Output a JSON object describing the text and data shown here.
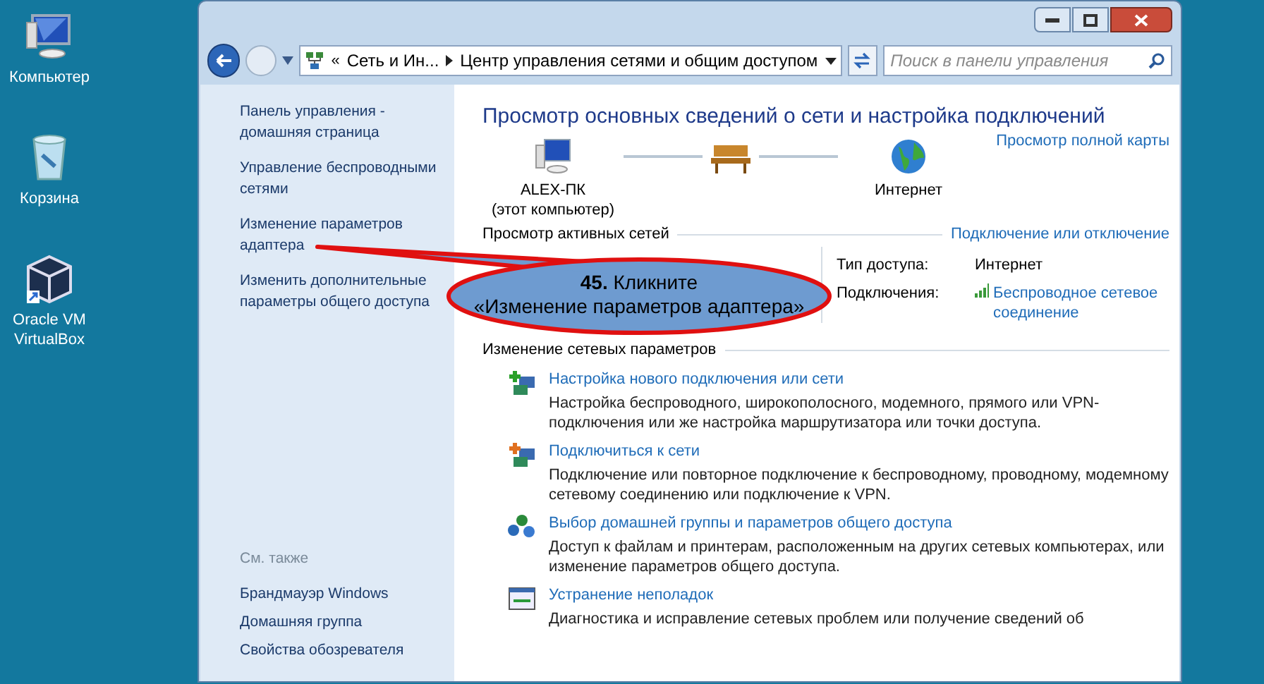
{
  "desktop_icons": [
    {
      "kind": "computer",
      "label": "Компьютер"
    },
    {
      "kind": "trash",
      "label": "Корзина"
    },
    {
      "kind": "virtualbox",
      "label": "Oracle VM VirtualBox"
    }
  ],
  "address_bar": {
    "overflow_chevron": "«",
    "breadcrumbs": [
      "Сеть и Ин...",
      "Центр управления сетями и общим доступом"
    ]
  },
  "search": {
    "placeholder": "Поиск в панели управления"
  },
  "sidebar": {
    "links": [
      "Панель управления - домашняя страница",
      "Управление беспроводными сетями",
      "Изменение параметров адаптера",
      "Изменить дополнительные параметры общего доступа"
    ],
    "see_also_title": "См. также",
    "see_also": [
      "Брандмауэр Windows",
      "Домашняя группа",
      "Свойства обозревателя"
    ]
  },
  "main": {
    "title": "Просмотр основных сведений о сети и настройка подключений",
    "map": {
      "computer": "ALEX-ПК",
      "computer_note": "(этот компьютер)",
      "internet": "Интернет",
      "full_map_link": "Просмотр полной карты"
    },
    "active_networks": {
      "heading": "Просмотр активных сетей",
      "link": "Подключение или отключение",
      "access_label": "Тип доступа:",
      "access_value": "Интернет",
      "connections_label": "Подключения:",
      "connection_link": "Беспроводное сетевое соединение"
    },
    "settings": {
      "heading": "Изменение сетевых параметров",
      "tasks": [
        {
          "kind": "new-connection",
          "title": "Настройка нового подключения или сети",
          "description": "Настройка беспроводного, широкополосного, модемного, прямого или VPN-подключения или же настройка маршрутизатора или точки доступа."
        },
        {
          "kind": "connect",
          "title": "Подключиться к сети",
          "description": "Подключение или повторное подключение к беспроводному, проводному, модемному сетевому соединению или подключение к VPN."
        },
        {
          "kind": "homegroup",
          "title": "Выбор домашней группы и параметров общего доступа",
          "description": "Доступ к файлам и принтерам, расположенным на других сетевых компьютерах, или изменение параметров общего доступа."
        },
        {
          "kind": "troubleshoot",
          "title": "Устранение неполадок",
          "description": "Диагностика и исправление сетевых проблем или получение сведений об"
        }
      ]
    }
  },
  "callout": {
    "line1": "**45.** Кликните",
    "line2": "«Изменение параметров адаптера»"
  }
}
